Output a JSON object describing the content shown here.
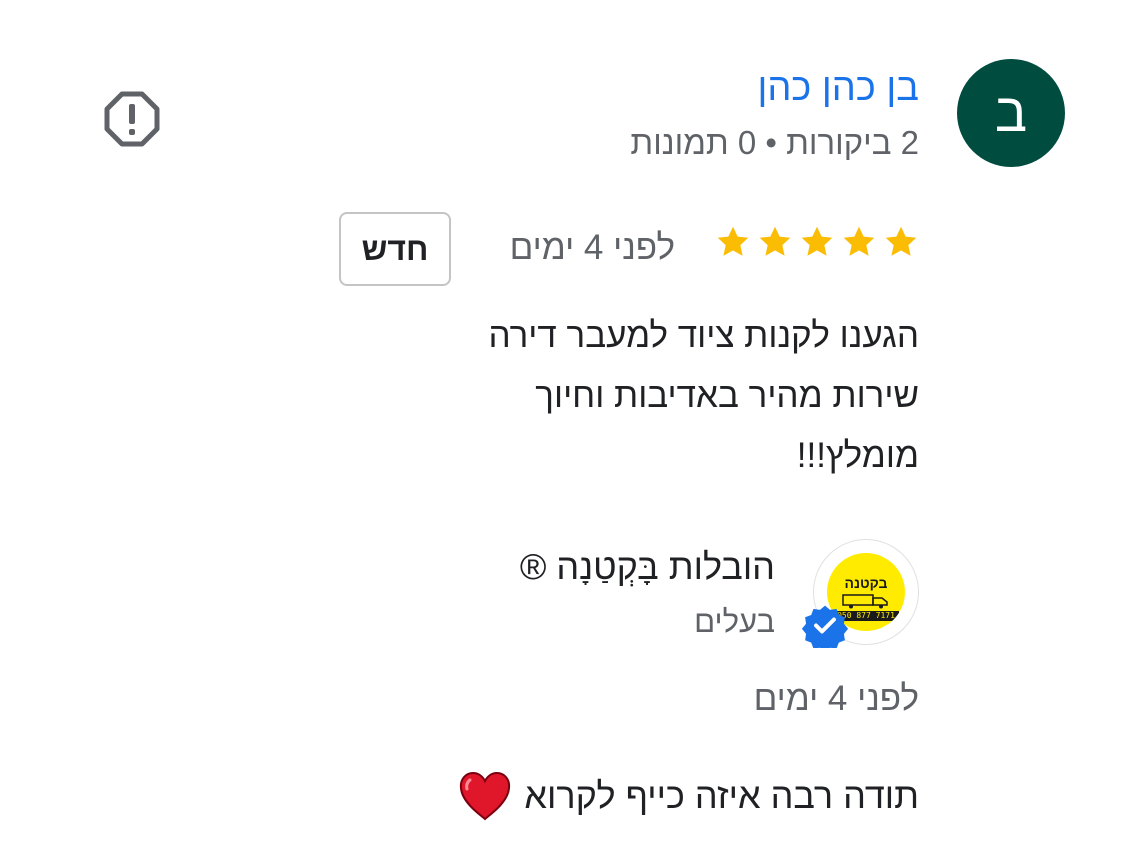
{
  "reviewer": {
    "avatar_letter": "ב",
    "avatar_color": "#004d40",
    "name": "בן כהן כהן",
    "meta": "2 ביקורות • 0 תמונות"
  },
  "review": {
    "rating": 5,
    "time": "לפני 4 ימים",
    "badge": "חדש",
    "lines": [
      "הגענו לקנות ציוד למעבר דירה",
      "שירות מהיר באדיבות וחיוך",
      "מומלץ!!!"
    ]
  },
  "owner": {
    "name": "הובלות בָּקְטַנָה ®",
    "role": "בעלים",
    "time": "לפני 4 ימים",
    "reply": "תודה רבה איזה כייף לקרוא",
    "logo": {
      "title": "בקטנה",
      "phone": "050 877 7171"
    }
  },
  "icons": {
    "report": "report-icon",
    "star": "star-icon",
    "verified": "verified-icon",
    "heart": "heart-icon"
  },
  "colors": {
    "link_blue": "#1a73e8",
    "star_yellow": "#fbbc04",
    "verified_blue": "#1a73e8",
    "secondary_text": "#5f6368"
  }
}
